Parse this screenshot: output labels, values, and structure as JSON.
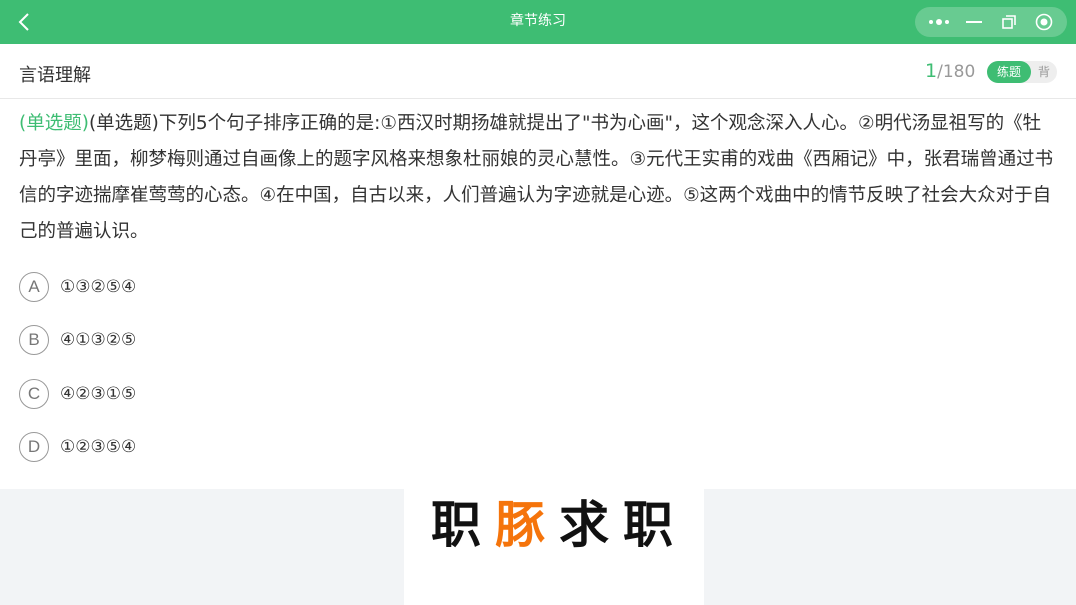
{
  "header": {
    "title": "章节练习",
    "back_icon": "chevron-left-icon",
    "capsule_icons": [
      "more-icon",
      "minimize-icon",
      "restore-icon",
      "close-circle-icon"
    ]
  },
  "subheader": {
    "section": "言语理解",
    "current": "1",
    "total": "/180",
    "mode_practice": "练题",
    "mode_recite": "背"
  },
  "question": {
    "type_label": "(单选题)",
    "text": "(单选题)下列5个句子排序正确的是:①西汉时期扬雄就提出了\"书为心画\"，这个观念深入人心。②明代汤显祖写的《牡丹亭》里面，柳梦梅则通过自画像上的题字风格来想象杜丽娘的灵心慧性。③元代王实甫的戏曲《西厢记》中，张君瑞曾通过书信的字迹揣摩崔莺莺的心态。④在中国，自古以来，人们普遍认为字迹就是心迹。⑤这两个戏曲中的情节反映了社会大众对于自己的普遍认识。"
  },
  "options": [
    {
      "letter": "A",
      "text": "①③②⑤④"
    },
    {
      "letter": "B",
      "text": "④①③②⑤"
    },
    {
      "letter": "C",
      "text": "④②③①⑤"
    },
    {
      "letter": "D",
      "text": "①②③⑤④"
    }
  ],
  "banner": {
    "brand_part1": "职",
    "brand_part2": "豚",
    "brand_part3": "求职"
  },
  "colors": {
    "primary": "#3ebd73",
    "accent": "#f5740b",
    "text": "#333333",
    "footer_bg": "#f2f4f6"
  }
}
